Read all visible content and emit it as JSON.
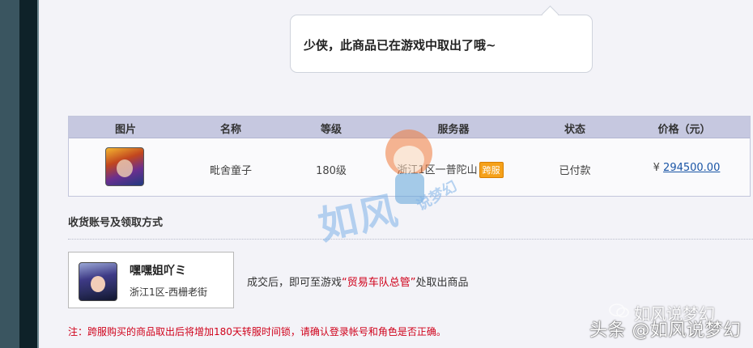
{
  "bubble": {
    "message": "少侠，此商品已在游戏中取出了哦~"
  },
  "table": {
    "headers": [
      "图片",
      "名称",
      "等级",
      "服务器",
      "状态",
      "价格（元）"
    ],
    "row": {
      "name": "毗舍童子",
      "level": "180级",
      "server": "浙江1区一普陀山",
      "server_badge": "跨服",
      "status": "已付款",
      "currency": "¥",
      "price": "294500.00"
    }
  },
  "section": {
    "title": "收货账号及领取方式"
  },
  "character": {
    "name": "嘿嘿姐吖ミ",
    "server": "浙江1区-西栅老街"
  },
  "instruction": {
    "prefix": "成交后，即可至游戏",
    "highlight": "“贸易车队总管”",
    "suffix": "处取出商品"
  },
  "note": "注：跨服购买的商品取出后将增加180天转服时间锁，请确认登录帐号和角色是否正确。",
  "watermarks": {
    "big": "如风",
    "small": "说梦幻",
    "wechat_line": "如风说梦幻",
    "toutiao": "头条 @如风说梦幻"
  },
  "colors": {
    "header_bg": "#c6c8e0",
    "link": "#1a55a6",
    "warning": "#d0021b",
    "badge": "#f5a11a"
  }
}
